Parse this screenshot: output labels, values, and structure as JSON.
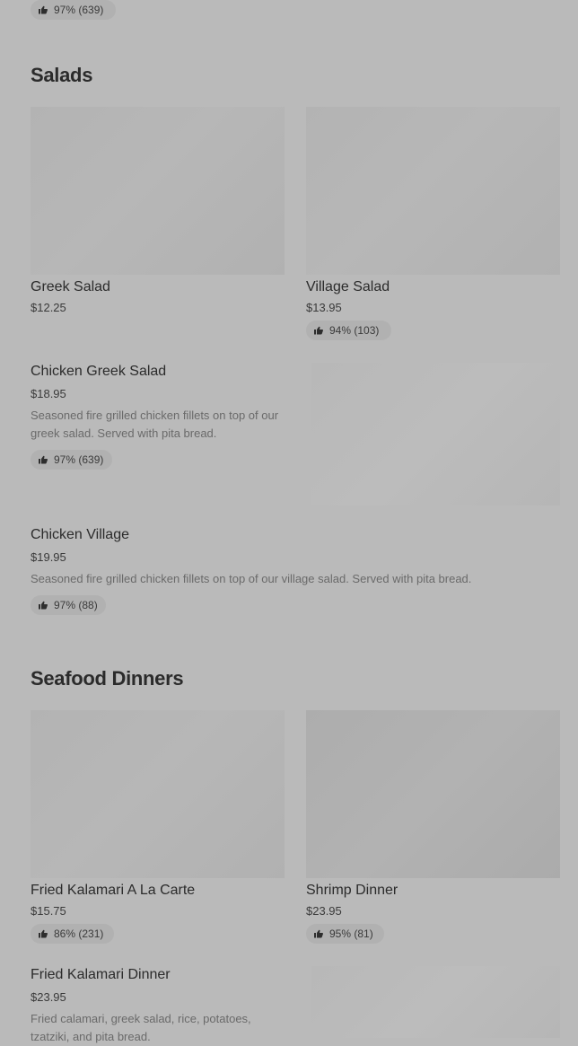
{
  "top_partial": {
    "rating": "97% (639)"
  },
  "sections": [
    {
      "title": "Salads",
      "items": [
        {
          "name": "Greek Salad",
          "price": "$12.25"
        },
        {
          "name": "Village Salad",
          "price": "$13.95",
          "rating": "94% (103)"
        },
        {
          "name": "Chicken Greek Salad",
          "price": "$18.95",
          "description": "Seasoned fire grilled chicken fillets on top of our greek salad. Served with pita bread.",
          "rating": "97% (639)"
        },
        {
          "name": "Chicken Village",
          "price": "$19.95",
          "description": "Seasoned fire grilled chicken fillets on top of our village salad. Served with pita bread.",
          "rating": "97% (88)"
        }
      ]
    },
    {
      "title": "Seafood Dinners",
      "items": [
        {
          "name": "Fried Kalamari A La Carte",
          "price": "$15.75",
          "rating": "86% (231)"
        },
        {
          "name": "Shrimp Dinner",
          "price": "$23.95",
          "rating": "95% (81)"
        },
        {
          "name": "Fried Kalamari Dinner",
          "price": "$23.95",
          "description": "Fried calamari, greek salad, rice, potatoes, tzatziki, and pita bread."
        }
      ]
    }
  ],
  "icons": {
    "rating": "thumbs-up-icon"
  }
}
